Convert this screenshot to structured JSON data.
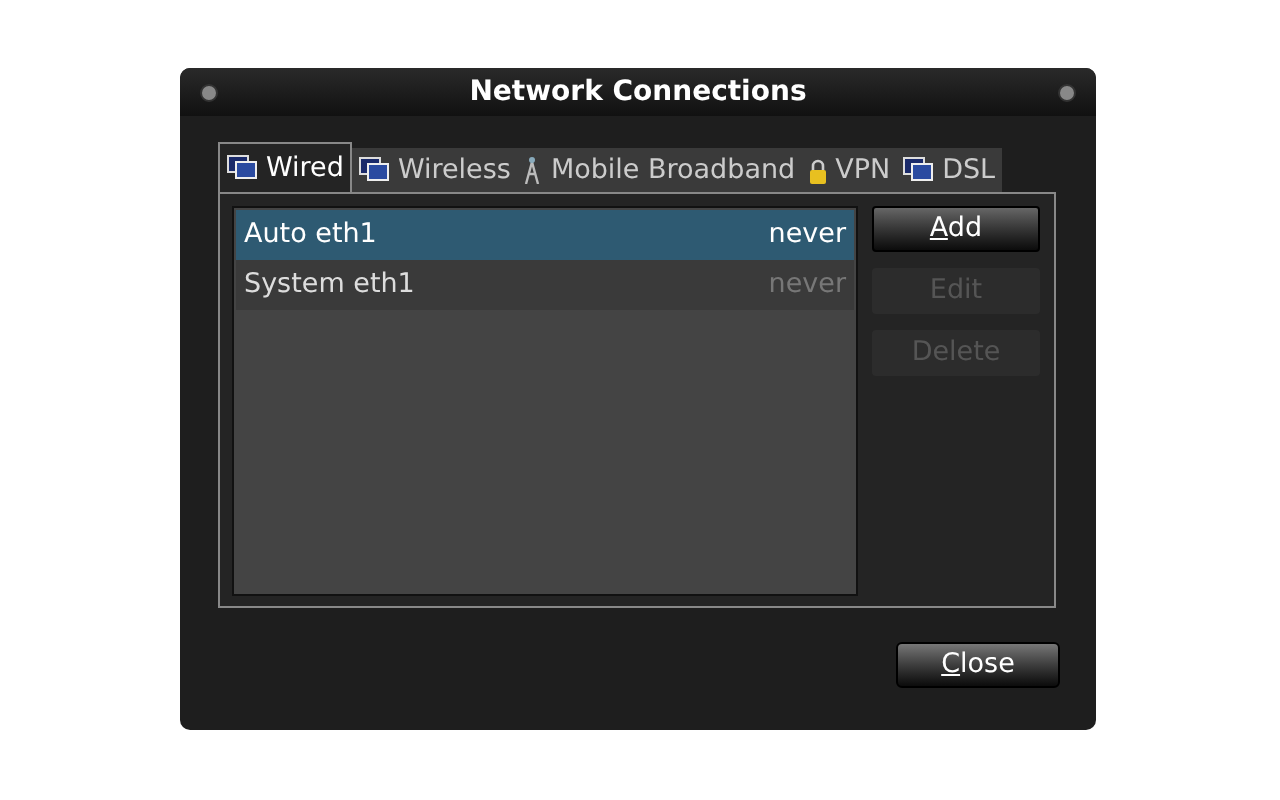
{
  "window": {
    "title": "Network Connections"
  },
  "tabs": [
    {
      "label": "Wired",
      "kind": "computer",
      "selected": true
    },
    {
      "label": "Wireless",
      "kind": "computer",
      "selected": false
    },
    {
      "label": "Mobile Broadband",
      "kind": "antenna",
      "selected": false
    },
    {
      "label": "VPN",
      "kind": "lock",
      "selected": false
    },
    {
      "label": "DSL",
      "kind": "computer",
      "selected": false
    }
  ],
  "connections": [
    {
      "name": "Auto eth1",
      "last_used": "never",
      "selected": true
    },
    {
      "name": "System eth1",
      "last_used": "never",
      "selected": false
    }
  ],
  "side_buttons": [
    {
      "label": "Add",
      "disabled": false,
      "mnemonic": true
    },
    {
      "label": "Edit",
      "disabled": true,
      "mnemonic": false
    },
    {
      "label": "Delete",
      "disabled": true,
      "mnemonic": false
    }
  ],
  "close_button": {
    "label": "Close",
    "mnemonic": true
  }
}
